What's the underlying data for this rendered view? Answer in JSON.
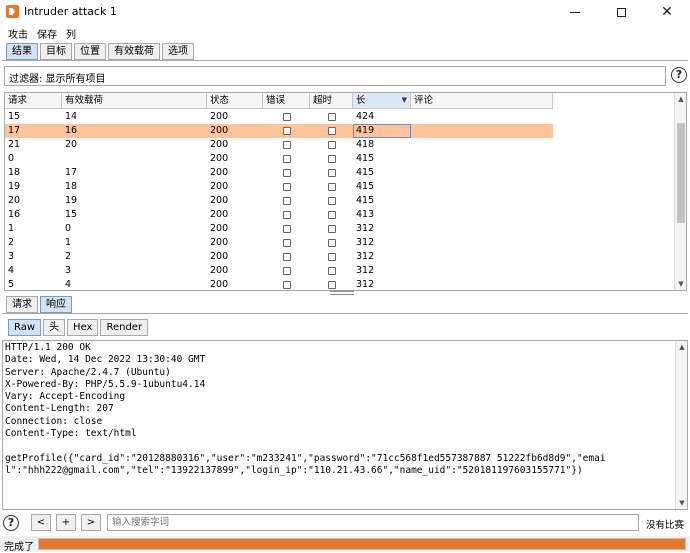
{
  "window": {
    "title": "Intruder attack 1"
  },
  "menu": [
    "攻击",
    "保存",
    "列"
  ],
  "tabs": [
    {
      "label": "结果",
      "active": true
    },
    {
      "label": "目标",
      "active": false
    },
    {
      "label": "位置",
      "active": false
    },
    {
      "label": "有效载荷",
      "active": false
    },
    {
      "label": "选项",
      "active": false
    }
  ],
  "filter": {
    "text": "过滤器:  显示所有项目"
  },
  "help_icon": "?",
  "table": {
    "columns": [
      "请求",
      "有效载荷",
      "状态",
      "错误",
      "超时",
      "长",
      "评论"
    ],
    "sort_indicator": "▼",
    "rows": [
      {
        "req": "15",
        "payload": "14",
        "status": "200",
        "length": "424",
        "selected": false
      },
      {
        "req": "17",
        "payload": "16",
        "status": "200",
        "length": "419",
        "selected": true
      },
      {
        "req": "21",
        "payload": "20",
        "status": "200",
        "length": "418",
        "selected": false
      },
      {
        "req": "0",
        "payload": "",
        "status": "200",
        "length": "415",
        "selected": false
      },
      {
        "req": "18",
        "payload": "17",
        "status": "200",
        "length": "415",
        "selected": false
      },
      {
        "req": "19",
        "payload": "18",
        "status": "200",
        "length": "415",
        "selected": false
      },
      {
        "req": "20",
        "payload": "19",
        "status": "200",
        "length": "415",
        "selected": false
      },
      {
        "req": "16",
        "payload": "15",
        "status": "200",
        "length": "413",
        "selected": false
      },
      {
        "req": "1",
        "payload": "0",
        "status": "200",
        "length": "312",
        "selected": false
      },
      {
        "req": "2",
        "payload": "1",
        "status": "200",
        "length": "312",
        "selected": false
      },
      {
        "req": "3",
        "payload": "2",
        "status": "200",
        "length": "312",
        "selected": false
      },
      {
        "req": "4",
        "payload": "3",
        "status": "200",
        "length": "312",
        "selected": false
      },
      {
        "req": "5",
        "payload": "4",
        "status": "200",
        "length": "312",
        "selected": false
      }
    ]
  },
  "req_resp_tabs": [
    {
      "label": "请求",
      "active": false
    },
    {
      "label": "响应",
      "active": true
    }
  ],
  "view_tabs": [
    {
      "label": "Raw",
      "active": true
    },
    {
      "label": "头",
      "active": false
    },
    {
      "label": "Hex",
      "active": false
    },
    {
      "label": "Render",
      "active": false
    }
  ],
  "response_text": "HTTP/1.1 200 OK\nDate: Wed, 14 Dec 2022 13:30:40 GMT\nServer: Apache/2.4.7 (Ubuntu)\nX-Powered-By: PHP/5.5.9-1ubuntu4.14\nVary: Accept-Encoding\nContent-Length: 207\nConnection: close\nContent-Type: text/html\n\ngetProfile({\"card_id\":\"20128880316\",\"user\":\"m233241\",\"password\":\"71cc568f1ed557387887 51222fb6d8d9\",\"emai\nl\":\"hhh222@gmail.com\",\"tel\":\"13922137899\",\"login_ip\":\"110.21.43.66\",\"name_uid\":\"520181197603155771\"})",
  "search": {
    "prev_label": "<",
    "add_label": "+",
    "next_label": ">",
    "placeholder": "输入搜索字词",
    "match_count": "没有比赛"
  },
  "status": {
    "text": "完成了",
    "progress": 1.0
  },
  "colors": {
    "accent": "#e8762c",
    "selected_row": "#ffc49a"
  }
}
